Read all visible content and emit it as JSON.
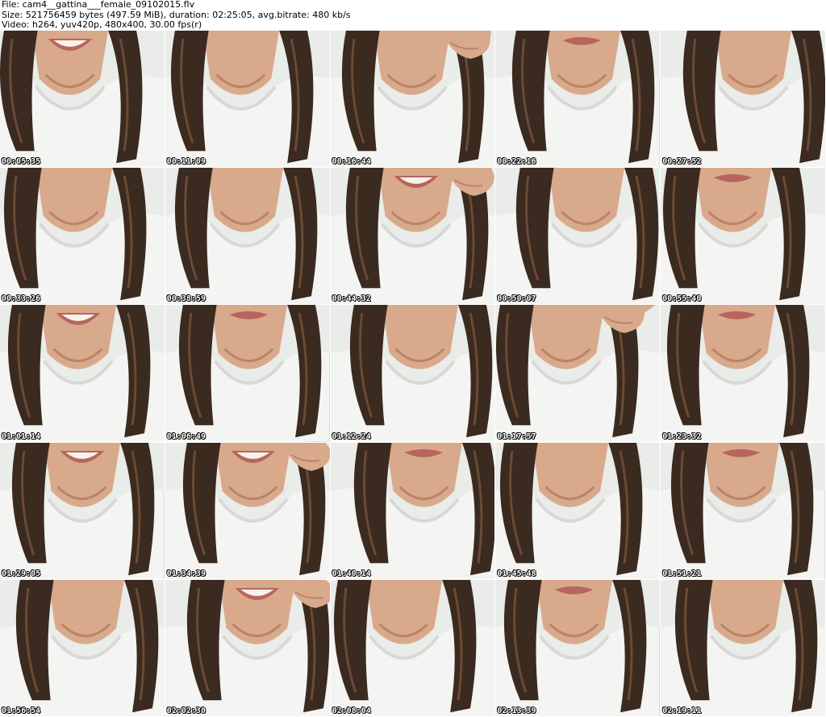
{
  "header": {
    "file_line": "File: cam4__gattina___female_09102015.flv",
    "size_line": "Size: 521756459 bytes (497.59 MiB), duration: 02:25:05, avg.bitrate: 480 kb/s",
    "video_line": "Video: h264, yuv420p, 480x400, 30.00 fps(r)"
  },
  "thumbnails": [
    {
      "timestamp": "00:05:35",
      "scene": "smile-face"
    },
    {
      "timestamp": "00:11:09",
      "scene": "shirt-hair"
    },
    {
      "timestamp": "00:16:44",
      "scene": "shirt-hand"
    },
    {
      "timestamp": "00:22:16",
      "scene": "lips-shirt"
    },
    {
      "timestamp": "00:27:52",
      "scene": "shirt-hair"
    },
    {
      "timestamp": "00:33:26",
      "scene": "shirt-hair"
    },
    {
      "timestamp": "00:38:59",
      "scene": "shirt-hair"
    },
    {
      "timestamp": "00:44:32",
      "scene": "smile-hand"
    },
    {
      "timestamp": "00:50:07",
      "scene": "shirt-hair"
    },
    {
      "timestamp": "00:55:40",
      "scene": "lips-shirt"
    },
    {
      "timestamp": "01:01:14",
      "scene": "smile-face"
    },
    {
      "timestamp": "01:06:49",
      "scene": "lips-shirt"
    },
    {
      "timestamp": "01:12:24",
      "scene": "shirt-hair"
    },
    {
      "timestamp": "01:17:57",
      "scene": "shirt-hand"
    },
    {
      "timestamp": "01:23:32",
      "scene": "lips-shirt"
    },
    {
      "timestamp": "01:29:05",
      "scene": "smile-face"
    },
    {
      "timestamp": "01:34:39",
      "scene": "smile-hand"
    },
    {
      "timestamp": "01:40:14",
      "scene": "lips-shirt"
    },
    {
      "timestamp": "01:45:48",
      "scene": "shirt-hair"
    },
    {
      "timestamp": "01:51:21",
      "scene": "lips-shirt"
    },
    {
      "timestamp": "01:56:54",
      "scene": "shirt-hair"
    },
    {
      "timestamp": "02:02:30",
      "scene": "smile-hand"
    },
    {
      "timestamp": "02:08:04",
      "scene": "shirt-hair"
    },
    {
      "timestamp": "02:13:39",
      "scene": "lips-shirt"
    },
    {
      "timestamp": "02:19:11",
      "scene": "shirt-hair"
    }
  ],
  "colors": {
    "background": "#ffffff",
    "header_text": "#000000",
    "timestamp_text": "#ffffff",
    "timestamp_outline": "#000000",
    "skin": "#d9a98c",
    "skin_shadow": "#b98468",
    "hair": "#3a2a20",
    "hair_light": "#6b4a34",
    "shirt": "#f4f4f2",
    "shirt_shadow": "#d8d8d6",
    "lips": "#b8655e",
    "teeth": "#f7f3ea",
    "backdrop": "#e9ece8",
    "chair": "#1c1c1c"
  }
}
